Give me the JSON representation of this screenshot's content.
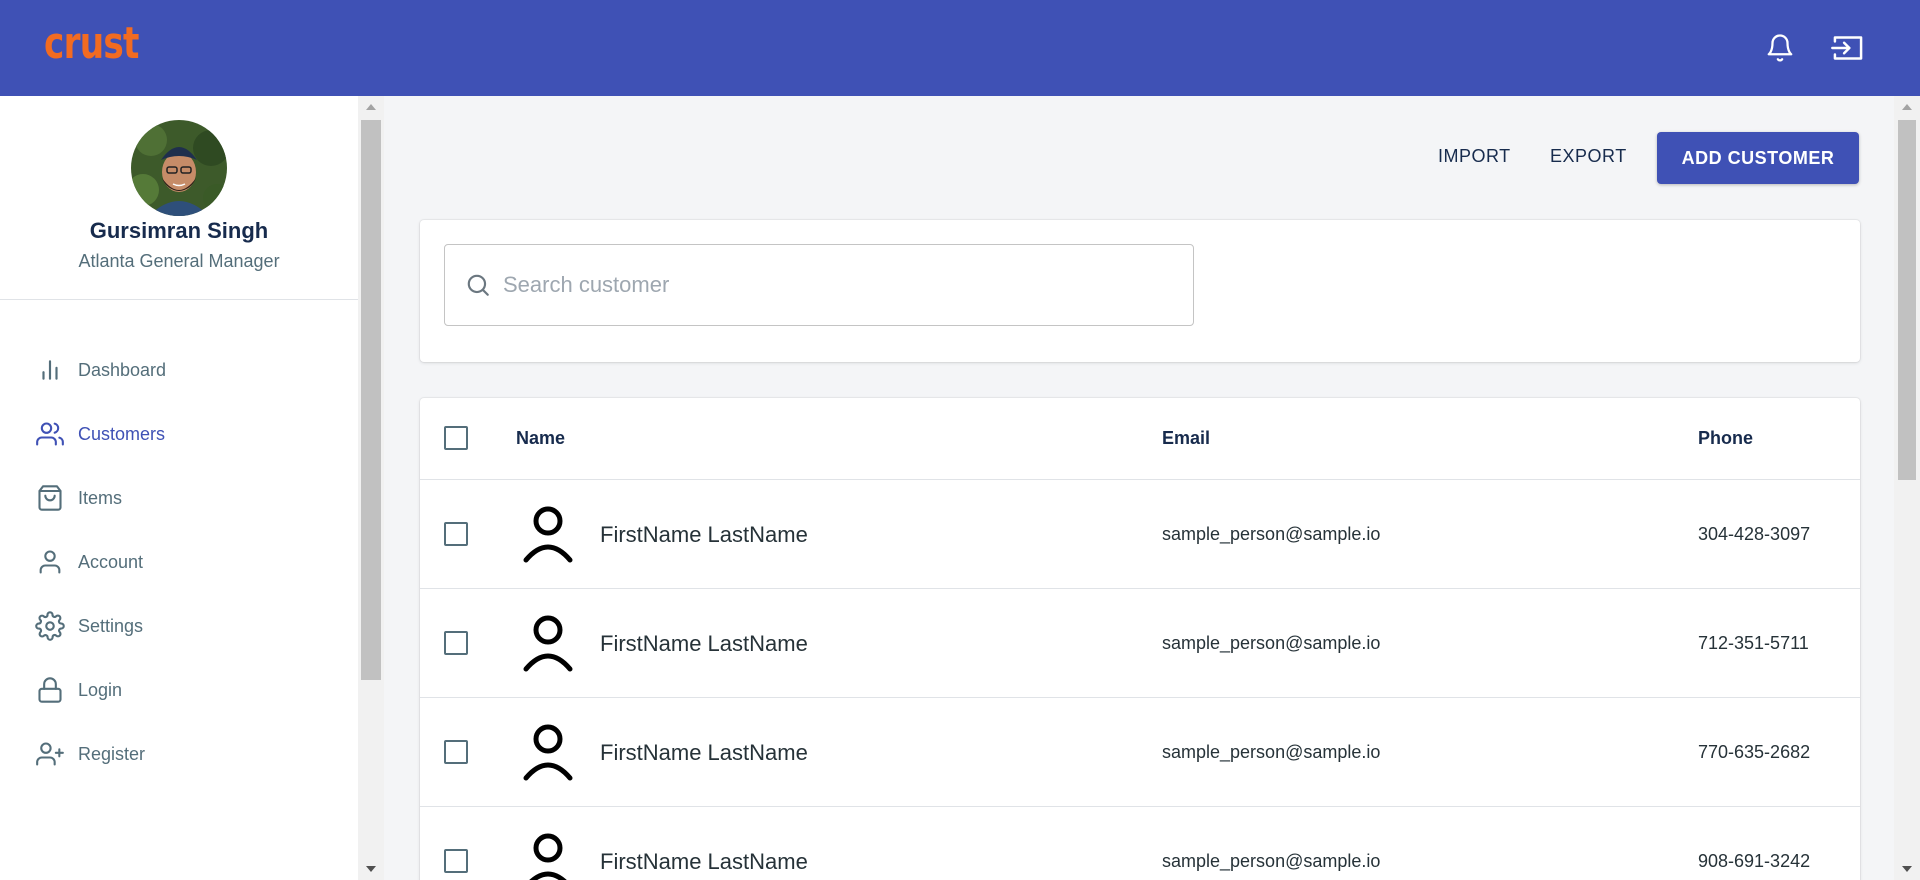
{
  "app": {
    "logo": "crust"
  },
  "topbar": {
    "icons": [
      "bell-icon",
      "logout-icon"
    ]
  },
  "profile": {
    "name": "Gursimran Singh",
    "role": "Atlanta General Manager"
  },
  "sidebar": {
    "items": [
      {
        "label": "Dashboard",
        "icon": "bar-chart-icon",
        "active": false
      },
      {
        "label": "Customers",
        "icon": "users-icon",
        "active": true
      },
      {
        "label": "Items",
        "icon": "shopping-bag-icon",
        "active": false
      },
      {
        "label": "Account",
        "icon": "user-icon",
        "active": false
      },
      {
        "label": "Settings",
        "icon": "gear-icon",
        "active": false
      },
      {
        "label": "Login",
        "icon": "lock-icon",
        "active": false
      },
      {
        "label": "Register",
        "icon": "user-plus-icon",
        "active": false
      }
    ]
  },
  "toolbar": {
    "import_label": "IMPORT",
    "export_label": "EXPORT",
    "add_label": "ADD CUSTOMER"
  },
  "search": {
    "placeholder": "Search customer",
    "value": ""
  },
  "table": {
    "headers": {
      "name": "Name",
      "email": "Email",
      "phone": "Phone"
    },
    "rows": [
      {
        "name": "FirstName LastName",
        "email": "sample_person@sample.io",
        "phone": "304-428-3097"
      },
      {
        "name": "FirstName LastName",
        "email": "sample_person@sample.io",
        "phone": "712-351-5711"
      },
      {
        "name": "FirstName LastName",
        "email": "sample_person@sample.io",
        "phone": "770-635-2682"
      },
      {
        "name": "FirstName LastName",
        "email": "sample_person@sample.io",
        "phone": "908-691-3242"
      }
    ]
  },
  "colors": {
    "primary": "#3f51b5",
    "logo": "#f26b21",
    "background": "#f4f5f7",
    "text": "#172b4d",
    "muted": "#546e7a"
  }
}
